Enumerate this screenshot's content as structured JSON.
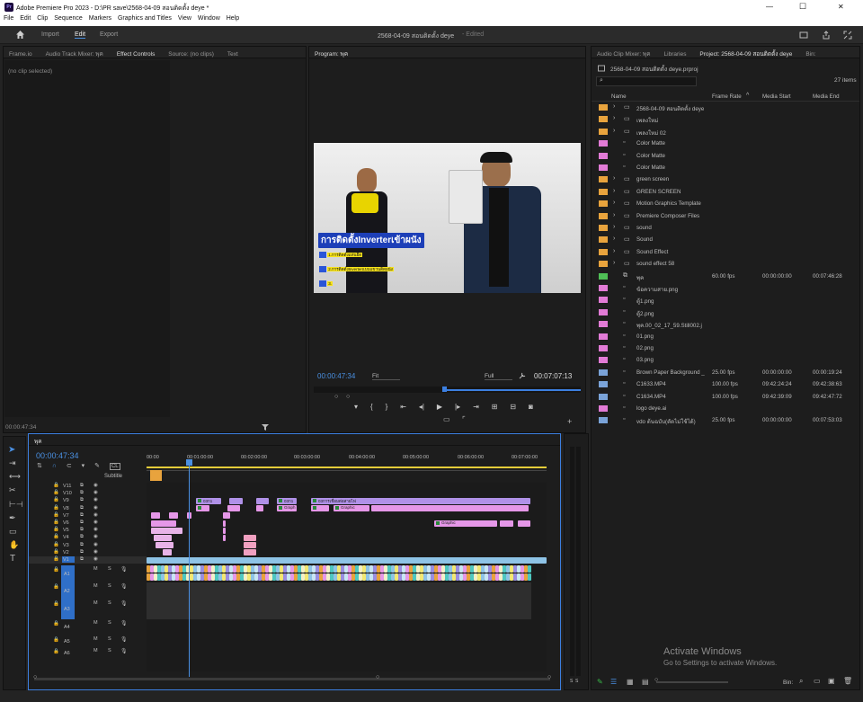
{
  "window": {
    "title": "Adobe Premiere Pro 2023 - D:\\PR save\\2568-04-09 สอนติดตั้ง deye *",
    "app_badge": "Pr",
    "controls": {
      "minimize": "—",
      "maximize": "☐",
      "close": "✕"
    }
  },
  "menu": [
    "File",
    "Edit",
    "Clip",
    "Sequence",
    "Markers",
    "Graphics and Titles",
    "View",
    "Window",
    "Help"
  ],
  "workspace": {
    "tabs": [
      "Import",
      "Edit",
      "Export"
    ],
    "active_tab": "Edit",
    "project_title": "2568-04-09 สอนติดตั้ง deye",
    "status": "- Edited"
  },
  "left_panel": {
    "tabs": [
      "Frame.io",
      "Audio Track Mixer: พุค",
      "Effect Controls",
      "Source: (no clips)",
      "Text"
    ],
    "active_tab": "Effect Controls",
    "empty_text": "(no clip selected)",
    "timecode": "00:00:47:34"
  },
  "program": {
    "tab": "Program: พุค",
    "video_title": "การติดตั้งInverterเข้าผนัง",
    "bullets": [
      "1.การติดตั้งแท่นยึด",
      "2.การติดตั้งInverterแบบแขวนติดผนัง",
      "3."
    ],
    "timecode": "00:00:47:34",
    "fit": "Fit",
    "quality": "Full",
    "duration": "00:07:07:13"
  },
  "project": {
    "tabs": [
      "Audio Clip Mixer: พุค",
      "Libraries",
      "Project: 2568-04-09 สอนติดตั้ง deye",
      "Bin:"
    ],
    "active_tab": "Project: 2568-04-09 สอนติดตั้ง deye",
    "file": "2568-04-09 สอนติดตั้ง deye.prproj",
    "count": "27 items",
    "columns": [
      "Name",
      "Frame Rate",
      "Media Start",
      "Media End"
    ],
    "items": [
      {
        "name": "2568-04-09 สอนติดตั้ง deye",
        "fps": "",
        "start": "",
        "end": "",
        "color": "#e8a33d",
        "type": "folder"
      },
      {
        "name": "เพลงใหม่",
        "fps": "",
        "start": "",
        "end": "",
        "color": "#e8a33d",
        "type": "folder"
      },
      {
        "name": "เพลงใหม่ 02",
        "fps": "",
        "start": "",
        "end": "",
        "color": "#e8a33d",
        "type": "folder"
      },
      {
        "name": "Color Matte",
        "fps": "",
        "start": "",
        "end": "",
        "color": "#e27bd6",
        "type": "file"
      },
      {
        "name": "Color Matte",
        "fps": "",
        "start": "",
        "end": "",
        "color": "#e27bd6",
        "type": "file"
      },
      {
        "name": "Color Matte",
        "fps": "",
        "start": "",
        "end": "",
        "color": "#e27bd6",
        "type": "file"
      },
      {
        "name": "green screen",
        "fps": "",
        "start": "",
        "end": "",
        "color": "#e8a33d",
        "type": "folder"
      },
      {
        "name": "GREEN SCREEN",
        "fps": "",
        "start": "",
        "end": "",
        "color": "#e8a33d",
        "type": "folder"
      },
      {
        "name": "Motion Graphics Template",
        "fps": "",
        "start": "",
        "end": "",
        "color": "#e8a33d",
        "type": "folder"
      },
      {
        "name": "Premiere Composer Files",
        "fps": "",
        "start": "",
        "end": "",
        "color": "#e8a33d",
        "type": "folder"
      },
      {
        "name": "sound",
        "fps": "",
        "start": "",
        "end": "",
        "color": "#e8a33d",
        "type": "folder"
      },
      {
        "name": "Sound",
        "fps": "",
        "start": "",
        "end": "",
        "color": "#e8a33d",
        "type": "folder"
      },
      {
        "name": "Sound Effect",
        "fps": "",
        "start": "",
        "end": "",
        "color": "#e8a33d",
        "type": "folder"
      },
      {
        "name": "sound effect  58",
        "fps": "",
        "start": "",
        "end": "",
        "color": "#e8a33d",
        "type": "folder"
      },
      {
        "name": "พุค",
        "fps": "60.00 fps",
        "start": "00:00:00:00",
        "end": "00:07:46:28",
        "color": "#4fbf56",
        "type": "seq"
      },
      {
        "name": "ข้อความสาย.png",
        "fps": "",
        "start": "",
        "end": "",
        "color": "#e27bd6",
        "type": "file"
      },
      {
        "name": "ตู้1.png",
        "fps": "",
        "start": "",
        "end": "",
        "color": "#e27bd6",
        "type": "file"
      },
      {
        "name": "ตู้2.png",
        "fps": "",
        "start": "",
        "end": "",
        "color": "#e27bd6",
        "type": "file"
      },
      {
        "name": "พุค.00_02_17_59.Still002.j",
        "fps": "",
        "start": "",
        "end": "",
        "color": "#e27bd6",
        "type": "file"
      },
      {
        "name": "01.png",
        "fps": "",
        "start": "",
        "end": "",
        "color": "#e27bd6",
        "type": "file"
      },
      {
        "name": "02.png",
        "fps": "",
        "start": "",
        "end": "",
        "color": "#e27bd6",
        "type": "file"
      },
      {
        "name": "03.png",
        "fps": "",
        "start": "",
        "end": "",
        "color": "#e27bd6",
        "type": "file"
      },
      {
        "name": "Brown Paper Background _",
        "fps": "25.00 fps",
        "start": "00:00:00:00",
        "end": "00:00:19:24",
        "color": "#7aa3d8",
        "type": "file"
      },
      {
        "name": "C1633.MP4",
        "fps": "100.00 fps",
        "start": "09:42:24:24",
        "end": "09:42:38:63",
        "color": "#7aa3d8",
        "type": "file"
      },
      {
        "name": "C1634.MP4",
        "fps": "100.00 fps",
        "start": "09:42:39:09",
        "end": "09:42:47:72",
        "color": "#7aa3d8",
        "type": "file"
      },
      {
        "name": "logo deye.ai",
        "fps": "",
        "start": "",
        "end": "",
        "color": "#e27bd6",
        "type": "file"
      },
      {
        "name": "vdo ต้นฉบับ(ตัดไม่ใช้ได้)",
        "fps": "25.00 fps",
        "start": "00:00:00:00",
        "end": "00:07:53:03",
        "color": "#7aa3d8",
        "type": "file"
      }
    ],
    "footer_label": "Bin:"
  },
  "timeline": {
    "tab": "พุค",
    "timecode": "00:00:47:34",
    "ruler": [
      "00:00",
      "00:01:00:00",
      "00:02:00:00",
      "00:03:00:00",
      "00:04:00:00",
      "00:05:00:00",
      "00:06:00:00",
      "00:07:00:00"
    ],
    "video_tracks": [
      "V11",
      "V10",
      "V9",
      "V8",
      "V7",
      "V6",
      "V5",
      "V4",
      "V3",
      "V2",
      "V1"
    ],
    "audio_tracks": [
      "A1",
      "A2",
      "A3",
      "A4",
      "A5",
      "A6"
    ],
    "subtitle_label": "Subtitle",
    "cl_label": "CL",
    "clip_labels": {
      "c1": "03ก1",
      "c2": "03ก1",
      "c3": "03การเชื่อมต่อสายไฟ",
      "g1": "Graph",
      "g2": "Graphic",
      "g3": "Graphic",
      "g4": "Graphic",
      "s1": "สาย"
    },
    "audio_buttons": {
      "mute": "M",
      "solo": "S"
    }
  },
  "activate": {
    "title": "Activate Windows",
    "subtitle": "Go to Settings to activate Windows."
  }
}
